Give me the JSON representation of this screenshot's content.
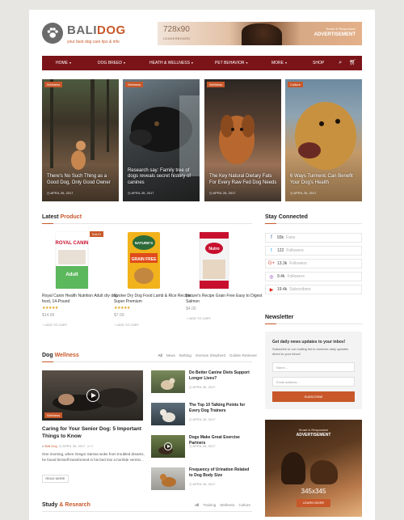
{
  "header": {
    "brand_part1": "BALI",
    "brand_part2": "DOG",
    "tagline": "your best dog care tips & info",
    "ad_size": "728x90",
    "ad_sub": "LEADERBOARD",
    "ad_small": "Smart & Responsive",
    "ad_title": "ADVERTISEMENT"
  },
  "nav": {
    "items": [
      "HOME",
      "DOG BREED",
      "HEATH & WELLNESS",
      "PET BEHAVIOR",
      "MORE",
      "SHOP"
    ],
    "search_icon": "search-icon",
    "cart_icon": "cart-icon"
  },
  "hero": [
    {
      "tag": "Wellness",
      "title": "There's No Such Thing as a Good Dog, Only Good Owner",
      "date": "APRIL 26, 2017"
    },
    {
      "tag": "Wellness",
      "title": "Research say: Family tree of dogs reveals secret history of canines",
      "date": "APRIL 26, 2017"
    },
    {
      "tag": "Wellness",
      "title": "The Key Natural Dietary Fats For Every Raw Fed Dog Needs",
      "date": "APRIL 26, 2017"
    },
    {
      "tag": "Culture",
      "title": "6 Ways Turmeric Can Benefit Your Dog's Health",
      "date": "APRIL 26, 2017"
    }
  ],
  "latest": {
    "title_a": "Latest",
    "title_b": "Product",
    "products": [
      {
        "name": "Royal Canin Health Nutrition Adult dry dog food, 14-Pound",
        "stars": "★★★★★",
        "price": "$14.99",
        "cart": "ADD TO CART",
        "sale": "SALE!"
      },
      {
        "name": "Evolve Dry Dog Food Lamb & Rice Recipe Super Premium",
        "stars": "★★★★★",
        "price": "$7.00",
        "cart": "ADD TO CART"
      },
      {
        "name": "Nature's Recipe Grain Free Easy to Digest Salmon",
        "price": "$4.00",
        "cart": "ADD TO CART"
      }
    ]
  },
  "stay_connected": {
    "title": "Stay Connected",
    "items": [
      {
        "icon": "f",
        "count": "93k",
        "label": "Fans",
        "color": "#3b5998"
      },
      {
        "icon": "t",
        "count": "122",
        "label": "Followers",
        "color": "#1da1f2"
      },
      {
        "icon": "G+",
        "count": "13.3k",
        "label": "Followers",
        "color": "#dd4b39"
      },
      {
        "icon": "◎",
        "count": "9.4k",
        "label": "Followers",
        "color": "#8a3ab9"
      },
      {
        "icon": "▶",
        "count": "19.4k",
        "label": "Subscribers",
        "color": "#e62117"
      }
    ]
  },
  "newsletter": {
    "title": "Newsletter",
    "heading": "Get daily news updates to your inbox!",
    "desc": "Subscribe to our mailing list to receives daily updates direct to your inbox!",
    "name_placeholder": "Name...",
    "email_placeholder": "Email address...",
    "button": "SUBSCRIBE"
  },
  "side_ad": {
    "small": "Smart & Responsive",
    "title": "ADVERTISEMENT",
    "size": "345x345",
    "button": "LEARN MORE"
  },
  "wellness": {
    "title_a": "Dog",
    "title_b": "Wellness",
    "filters": [
      "All",
      "News",
      "Bulldog",
      "German Shepherd",
      "Golden Retriever"
    ],
    "main": {
      "tag": "Wellness",
      "title": "Caring for Your Senior Dog: 5 Important Things to Know",
      "by": "Bali Dog",
      "date": "APRIL 26, 2017",
      "comments": "0",
      "excerpt": "One morning, when Gregor Samsa woke from troubled dreams, he found himself transformed in his bed into a horrible vermin...",
      "read_more": "READ MORE"
    },
    "posts": [
      {
        "title": "Do Better Canine Diets Support Longer Lives?",
        "date": "APRIL 26, 2017"
      },
      {
        "title": "The Top 10 Talking Points for Every Dog Trainers",
        "date": "APRIL 26, 2017"
      },
      {
        "title": "Dogs Make Great Exercise Partners",
        "date": "APRIL 26, 2017"
      },
      {
        "title": "Frequency of Urination Related to Dog Body Size",
        "date": "APRIL 26, 2017"
      }
    ]
  },
  "study": {
    "title_a": "Study",
    "title_b": "& Research",
    "filters": [
      "All",
      "Training",
      "Wellness",
      "Culture"
    ]
  }
}
